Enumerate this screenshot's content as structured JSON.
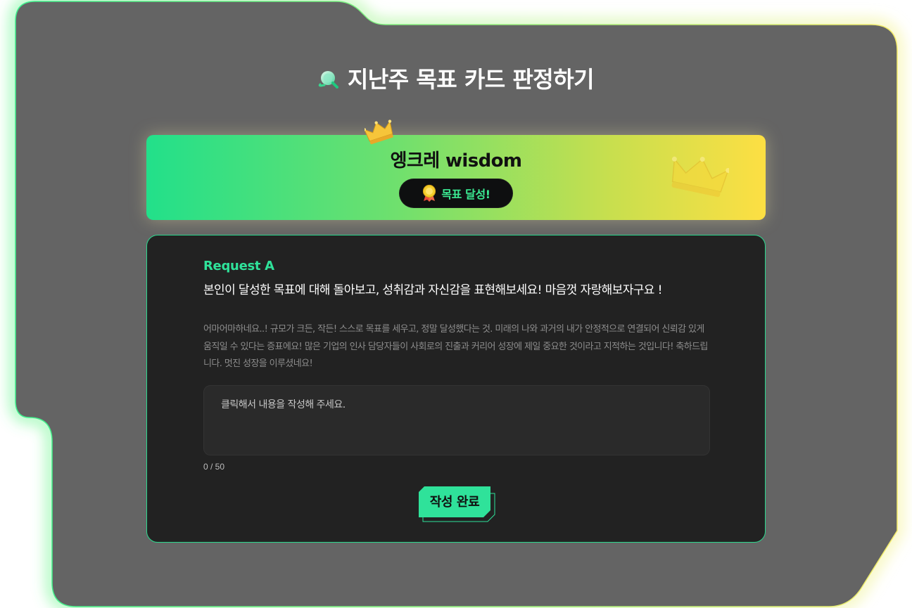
{
  "colors": {
    "accent": "#2fe29a",
    "frame_fill": "#646464",
    "card_fill": "#222222",
    "banner_start": "#22e08a",
    "banner_end": "#fddf43"
  },
  "page": {
    "title": "지난주 목표 카드 판정하기",
    "title_icon": "magnifier-icon"
  },
  "banner": {
    "name": "엥크레 wisdom",
    "crown_icon": "crown-icon",
    "badge_icon": "medal-icon",
    "badge_label": "목표 달성!"
  },
  "request": {
    "label": "Request A",
    "question": "본인이 달성한 목표에 대해 돌아보고, 성취감과 자신감을 표현해보세요! 마음껏 자랑해보자구요 !",
    "description": "어마어마하네요..! 규모가 크든, 작든! 스스로 목표를 세우고, 정말 달성했다는 것. 미래의 나와 과거의 내가 안정적으로 연결되어 신뢰감 있게 움직일 수 있다는 증표에요! 많은 기업의 인사 담당자들이 사회로의 진출과 커리어 성장에 제일 중요한 것이라고 지적하는 것입니다! 축하드립니다. 멋진 성장을 이루셨네요!"
  },
  "answer": {
    "placeholder": "클릭해서 내용을 작성해 주세요.",
    "value": "",
    "counter": "0 / 50"
  },
  "actions": {
    "submit_label": "작성 완료"
  }
}
